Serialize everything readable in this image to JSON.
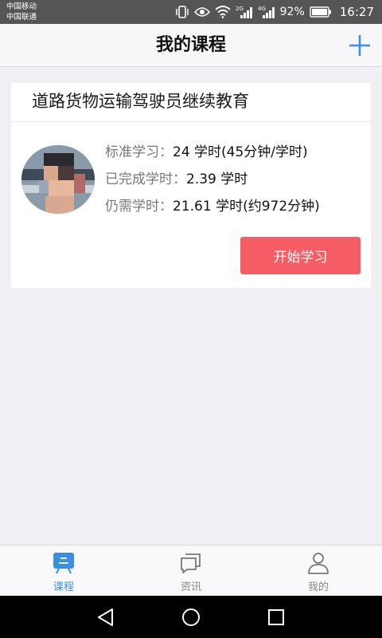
{
  "status_bar": {
    "carrier_1": "中国移动",
    "carrier_2": "中国联通",
    "signal_1_label": "2G",
    "signal_2_label": "4G",
    "battery": "92%",
    "time": "16:27"
  },
  "header": {
    "title": "我的课程",
    "add_icon": "plus-icon",
    "accent_color": "#3b8fe0"
  },
  "course": {
    "title": "道路货物运输驾驶员继续教育",
    "standard_label": "标准学习：",
    "standard_value": "24 学时(45分钟/学时)",
    "completed_label": "已完成学时：",
    "completed_value": "2.39 学时",
    "remaining_label": "仍需学时：",
    "remaining_value": "21.61 学时(约972分钟)",
    "start_button": "开始学习",
    "button_color": "#f65c64"
  },
  "bottom_nav": {
    "items": [
      {
        "label": "课程",
        "icon": "course-icon",
        "active": true
      },
      {
        "label": "资讯",
        "icon": "news-icon",
        "active": false
      },
      {
        "label": "我的",
        "icon": "profile-icon",
        "active": false
      }
    ]
  },
  "system_nav": {
    "back_icon": "back-triangle-icon",
    "home_icon": "home-circle-icon",
    "recent_icon": "recent-square-icon"
  }
}
